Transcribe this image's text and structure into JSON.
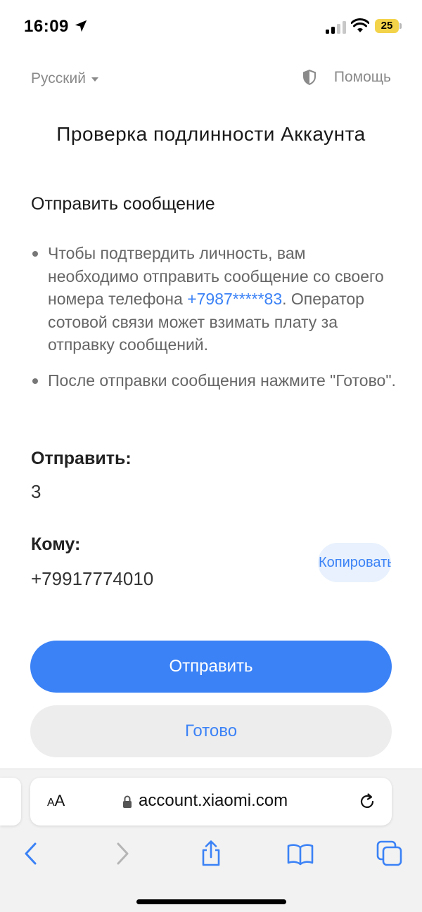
{
  "status_bar": {
    "time": "16:09",
    "battery": "25"
  },
  "header": {
    "language": "Русский",
    "help": "Помощь"
  },
  "page": {
    "title": "Проверка подлинности Аккаунта",
    "section_title": "Отправить сообщение",
    "bullet1_before": "Чтобы подтвердить личность, вам необходимо отправить сообщение со своего номера телефона ",
    "bullet1_phone": "+7987*****83",
    "bullet1_after": ". Оператор сотовой связи может взимать плату за отправку сообщений.",
    "bullet2": "После отправки сообщения нажмите \"Готово\".",
    "send_label": "Отправить:",
    "send_value": "3",
    "to_label": "Кому:",
    "to_value": "+79917774010",
    "copy_button": "Копировать",
    "send_button": "Отправить",
    "done_button": "Готово"
  },
  "browser": {
    "text_size_small": "A",
    "text_size_large": "A",
    "url": "account.xiaomi.com"
  },
  "colors": {
    "accent": "#3b82f6",
    "battery": "#f3d34a"
  }
}
